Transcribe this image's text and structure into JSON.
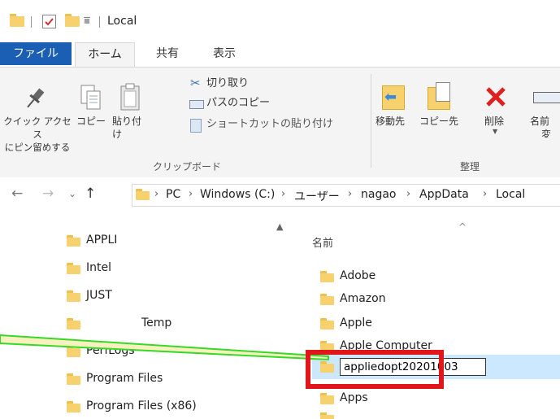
{
  "window": {
    "title": "Local"
  },
  "tabs": {
    "file": "ファイル",
    "home": "ホーム",
    "share": "共有",
    "view": "表示"
  },
  "ribbon": {
    "pin": "クイック アクセス\nにピン留めする",
    "copy": "コピー",
    "paste": "貼り付け",
    "cut": "切り取り",
    "copy_path": "パスのコピー",
    "paste_shortcut": "ショートカットの貼り付け",
    "clipboard_group": "クリップボード",
    "move_to": "移動先",
    "copy_to": "コピー先",
    "delete": "削除",
    "rename_line1": "名前",
    "rename_line2": "変更",
    "organize_group": "整理"
  },
  "address": {
    "crumbs": [
      "PC",
      "Windows (C:)",
      "ユーザー",
      "nagao",
      "AppData",
      "Local"
    ]
  },
  "nav_items": [
    "APPLI",
    "Intel",
    "JUST",
    "Temp",
    "PerfLogs",
    "Program Files",
    "Program Files (x86)"
  ],
  "file_list": {
    "column_name": "名前",
    "items": [
      "Adobe",
      "Amazon",
      "Apple",
      "Apple Computer",
      "Apps"
    ],
    "rename_value": "appliedopt20201003"
  },
  "annotation": {
    "highlight_color": "#e0161b",
    "callout_color": "#37d826",
    "callout_fill": "#f6f1bf"
  },
  "colors": {
    "accent": "#1a5fb4",
    "folder": "#f7d16e",
    "delete_red": "#e02020",
    "move_arrow": "#3c8ad8"
  }
}
